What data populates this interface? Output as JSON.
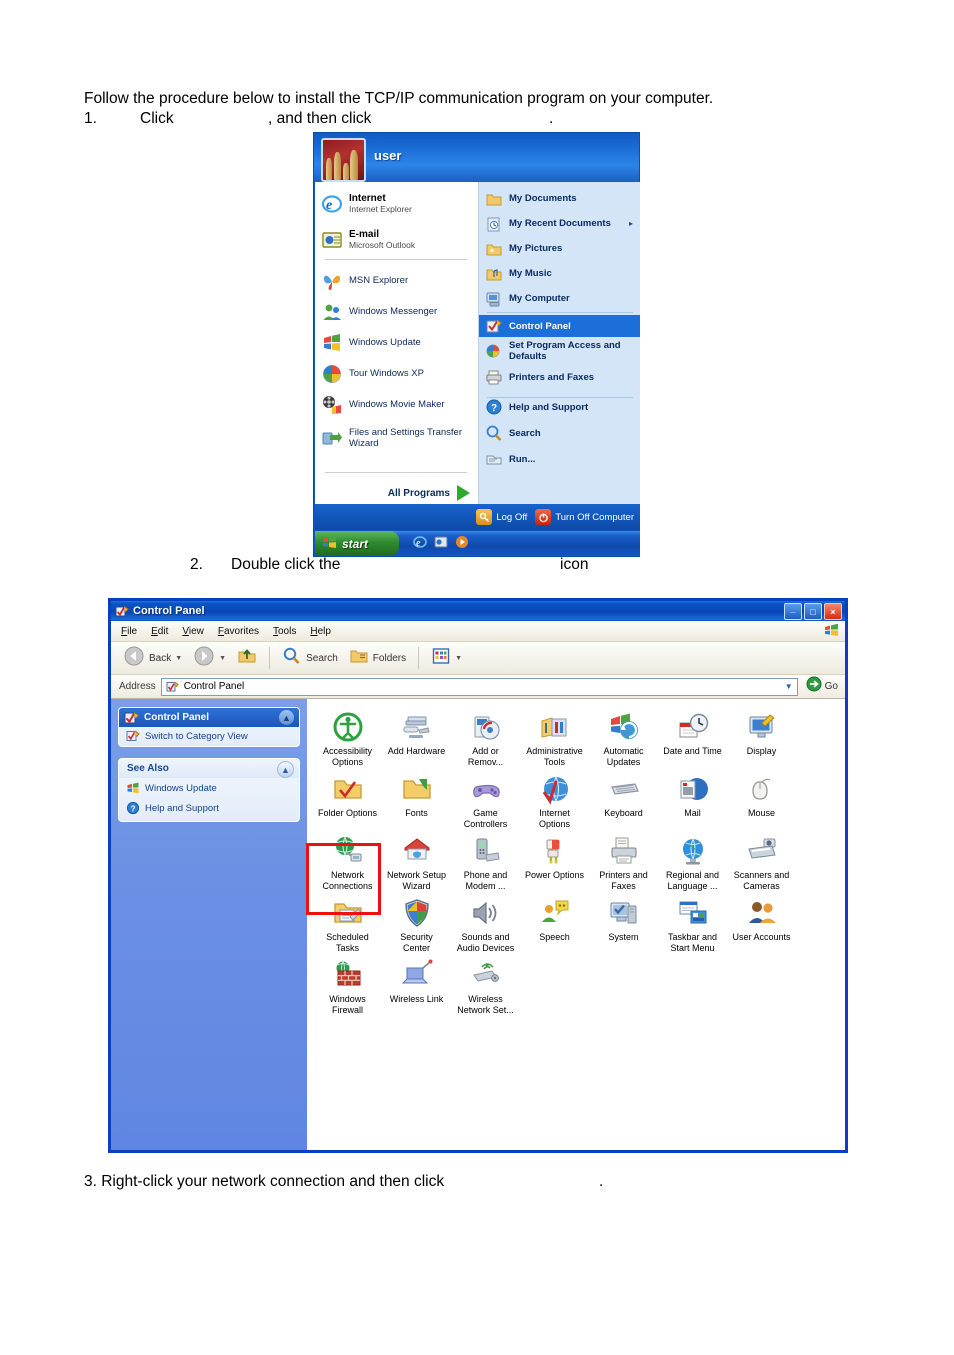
{
  "document": {
    "intro": "Follow the procedure below to install the TCP/IP communication program on your computer.",
    "step1": "1.\tClick\t, and then click\t.",
    "step2": "2.\tDouble click the\t\t\t\ticon",
    "step3": "3. Right-click your network connection and then click\t."
  },
  "start_menu": {
    "username": "user",
    "left_items": [
      {
        "label": "Internet",
        "sublabel": "Internet Explorer",
        "icon": "internet-explorer-icon"
      },
      {
        "label": "E-mail",
        "sublabel": "Microsoft Outlook",
        "icon": "outlook-icon"
      },
      {
        "label": "MSN Explorer",
        "sublabel": "",
        "icon": "msn-butterfly-icon"
      },
      {
        "label": "Windows Messenger",
        "sublabel": "",
        "icon": "messenger-icon"
      },
      {
        "label": "Windows Update",
        "sublabel": "",
        "icon": "windows-update-icon"
      },
      {
        "label": "Tour Windows XP",
        "sublabel": "",
        "icon": "tour-windows-xp-icon"
      },
      {
        "label": "Windows Movie Maker",
        "sublabel": "",
        "icon": "movie-maker-icon"
      },
      {
        "label": "Files and Settings Transfer\nWizard",
        "sublabel": "",
        "icon": "transfer-wizard-icon"
      }
    ],
    "all_programs": "All Programs",
    "right_items": [
      {
        "label": "My Documents",
        "icon": "folder-documents-icon",
        "selected": false,
        "arrow": false
      },
      {
        "label": "My Recent Documents",
        "icon": "recent-documents-icon",
        "selected": false,
        "arrow": true
      },
      {
        "label": "My Pictures",
        "icon": "folder-pictures-icon",
        "selected": false,
        "arrow": false
      },
      {
        "label": "My Music",
        "icon": "folder-music-icon",
        "selected": false,
        "arrow": false
      },
      {
        "label": "My Computer",
        "icon": "my-computer-icon",
        "selected": false,
        "arrow": false
      },
      {
        "label": "Control Panel",
        "icon": "control-panel-icon",
        "selected": true,
        "arrow": false
      },
      {
        "label": "Set Program Access and\nDefaults",
        "icon": "set-program-access-icon",
        "selected": false,
        "arrow": false
      },
      {
        "label": "Printers and Faxes",
        "icon": "printer-icon",
        "selected": false,
        "arrow": false
      },
      {
        "label": "Help and Support",
        "icon": "help-icon",
        "selected": false,
        "arrow": false
      },
      {
        "label": "Search",
        "icon": "search-icon",
        "selected": false,
        "arrow": false
      },
      {
        "label": "Run...",
        "icon": "run-icon",
        "selected": false,
        "arrow": false
      }
    ],
    "log_off": "Log Off",
    "turn_off": "Turn Off Computer",
    "start_button": "start"
  },
  "control_panel": {
    "window_title": "Control Panel",
    "window_buttons": {
      "minimize": "_",
      "maximize": "□",
      "close": "×"
    },
    "menu": [
      "File",
      "Edit",
      "View",
      "Favorites",
      "Tools",
      "Help"
    ],
    "toolbar": {
      "back": "Back",
      "forward": "",
      "up": "",
      "search": "Search",
      "folders": "Folders",
      "views": ""
    },
    "address": {
      "label": "Address",
      "value": "Control Panel",
      "go": "Go"
    },
    "sidebar": {
      "panel1_title": "Control Panel",
      "panel1_items": [
        {
          "label": "Switch to Category View",
          "icon": "control-panel-icon"
        }
      ],
      "panel2_title": "See Also",
      "panel2_items": [
        {
          "label": "Windows Update",
          "icon": "windows-update-icon"
        },
        {
          "label": "Help and Support",
          "icon": "help-icon"
        }
      ]
    },
    "items": [
      {
        "label": "Accessibility\nOptions",
        "icon": "accessibility-icon",
        "highlighted": false
      },
      {
        "label": "Add Hardware",
        "icon": "add-hardware-icon",
        "highlighted": false
      },
      {
        "label": "Add or\nRemov...",
        "icon": "add-remove-programs-icon",
        "highlighted": false
      },
      {
        "label": "Administrative\nTools",
        "icon": "administrative-tools-icon",
        "highlighted": false
      },
      {
        "label": "Automatic\nUpdates",
        "icon": "automatic-updates-icon",
        "highlighted": false
      },
      {
        "label": "Date and Time",
        "icon": "date-time-icon",
        "highlighted": false
      },
      {
        "label": "Display",
        "icon": "display-icon",
        "highlighted": false
      },
      {
        "label": "Folder Options",
        "icon": "folder-options-icon",
        "highlighted": false
      },
      {
        "label": "Fonts",
        "icon": "fonts-icon",
        "highlighted": false
      },
      {
        "label": "Game\nControllers",
        "icon": "game-controllers-icon",
        "highlighted": false
      },
      {
        "label": "Internet\nOptions",
        "icon": "internet-options-icon",
        "highlighted": false
      },
      {
        "label": "Keyboard",
        "icon": "keyboard-icon",
        "highlighted": false
      },
      {
        "label": "Mail",
        "icon": "mail-icon",
        "highlighted": false
      },
      {
        "label": "Mouse",
        "icon": "mouse-icon",
        "highlighted": false
      },
      {
        "label": "Network\nConnections",
        "icon": "network-connections-icon",
        "highlighted": true
      },
      {
        "label": "Network Setup\nWizard",
        "icon": "network-setup-wizard-icon",
        "highlighted": false
      },
      {
        "label": "Phone and\nModem ...",
        "icon": "phone-modem-icon",
        "highlighted": false
      },
      {
        "label": "Power Options",
        "icon": "power-options-icon",
        "highlighted": false
      },
      {
        "label": "Printers and\nFaxes",
        "icon": "printers-faxes-icon",
        "highlighted": false
      },
      {
        "label": "Regional and\nLanguage ...",
        "icon": "regional-language-icon",
        "highlighted": false
      },
      {
        "label": "Scanners and\nCameras",
        "icon": "scanners-cameras-icon",
        "highlighted": false
      },
      {
        "label": "Scheduled\nTasks",
        "icon": "scheduled-tasks-icon",
        "highlighted": false
      },
      {
        "label": "Security\nCenter",
        "icon": "security-center-icon",
        "highlighted": false
      },
      {
        "label": "Sounds and\nAudio Devices",
        "icon": "sounds-audio-icon",
        "highlighted": false
      },
      {
        "label": "Speech",
        "icon": "speech-icon",
        "highlighted": false
      },
      {
        "label": "System",
        "icon": "system-icon",
        "highlighted": false
      },
      {
        "label": "Taskbar and\nStart Menu",
        "icon": "taskbar-start-menu-icon",
        "highlighted": false
      },
      {
        "label": "User Accounts",
        "icon": "user-accounts-icon",
        "highlighted": false
      },
      {
        "label": "Windows\nFirewall",
        "icon": "windows-firewall-icon",
        "highlighted": false
      },
      {
        "label": "Wireless Link",
        "icon": "wireless-link-icon",
        "highlighted": false
      },
      {
        "label": "Wireless\nNetwork Set...",
        "icon": "wireless-network-setup-icon",
        "highlighted": false
      }
    ]
  },
  "colors": {
    "highlight_red": "#ee1111",
    "window_border_blue": "#0a3fc0",
    "title_blue": "#0a53c8",
    "sidebar_blue": "#6b90e4",
    "selection_blue": "#1c6fd8"
  }
}
